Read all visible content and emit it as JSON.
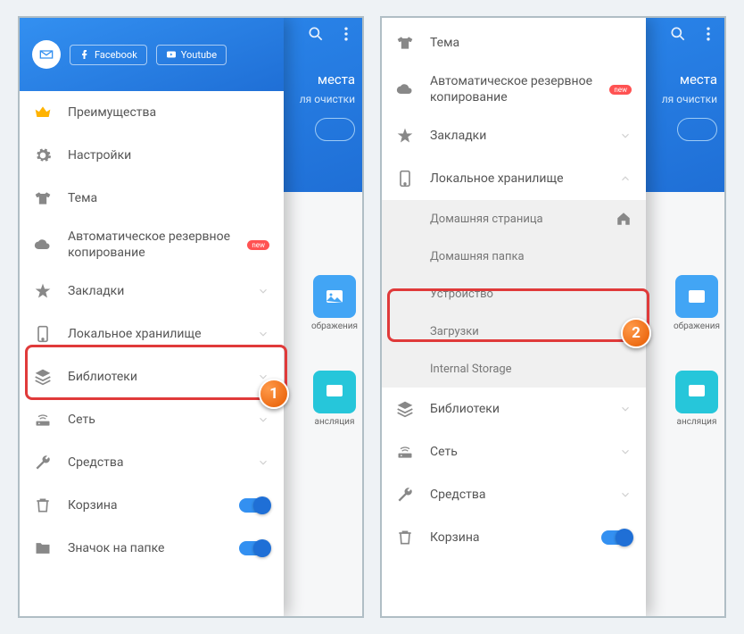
{
  "header": {
    "facebook": "Facebook",
    "youtube": "Youtube"
  },
  "bg": {
    "title_part": "места",
    "subtitle_part": "ля очистки",
    "tile1": "ображения",
    "tile2": "ансляция"
  },
  "menu": {
    "advantages": "Преимущества",
    "settings": "Настройки",
    "theme": "Тема",
    "backup": "Автоматическое резервное копирование",
    "new": "new",
    "bookmarks": "Закладки",
    "local_storage": "Локальное хранилище",
    "libraries": "Библиотеки",
    "network": "Сеть",
    "tools": "Средства",
    "trash": "Корзина",
    "folder_icon": "Значок на папке"
  },
  "sub": {
    "home_page": "Домашняя страница",
    "home_folder": "Домашняя папка",
    "device": "Устройство",
    "downloads": "Загрузки",
    "internal": "Internal Storage"
  },
  "callouts": {
    "one": "1",
    "two": "2"
  }
}
